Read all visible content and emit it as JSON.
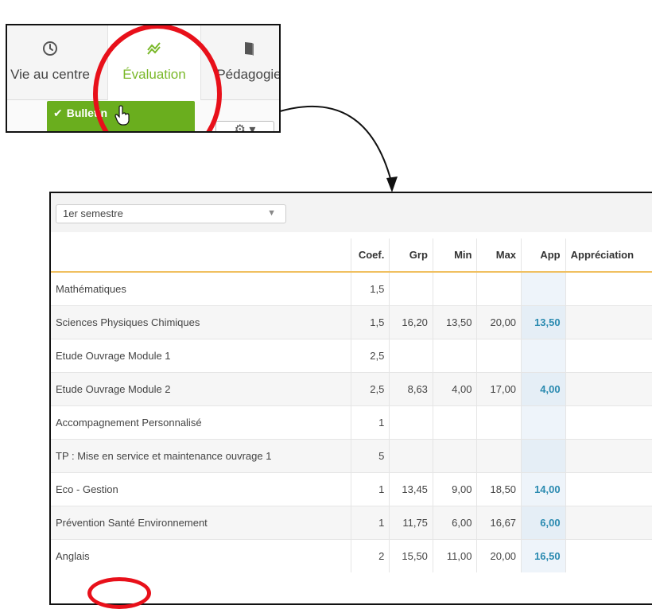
{
  "nav": {
    "tabs": [
      {
        "label": "Vie au centre",
        "icon": "clock-icon"
      },
      {
        "label": "Évaluation",
        "icon": "trend-chart-icon"
      },
      {
        "label": "Pédagogie",
        "icon": "book-icon"
      }
    ],
    "bulletin_label": "Bulletin",
    "gear_caret": "▾",
    "active_color": "#7ab829"
  },
  "panel": {
    "semester": "1er semestre",
    "columns": [
      "Coef.",
      "Grp",
      "Min",
      "Max",
      "App",
      "Appréciation"
    ],
    "rows": [
      {
        "subject": "Mathématiques",
        "coef": "1,5",
        "grp": "",
        "min": "",
        "max": "",
        "app": ""
      },
      {
        "subject": "Sciences Physiques Chimiques",
        "coef": "1,5",
        "grp": "16,20",
        "min": "13,50",
        "max": "20,00",
        "app": "13,50"
      },
      {
        "subject": "Etude Ouvrage Module 1",
        "coef": "2,5",
        "grp": "",
        "min": "",
        "max": "",
        "app": ""
      },
      {
        "subject": "Etude Ouvrage Module 2",
        "coef": "2,5",
        "grp": "8,63",
        "min": "4,00",
        "max": "17,00",
        "app": "4,00"
      },
      {
        "subject": "Accompagnement Personnalisé",
        "coef": "1",
        "grp": "",
        "min": "",
        "max": "",
        "app": ""
      },
      {
        "subject": "TP : Mise en service et maintenance ouvrage 1",
        "coef": "5",
        "grp": "",
        "min": "",
        "max": "",
        "app": ""
      },
      {
        "subject": "Eco - Gestion",
        "coef": "1",
        "grp": "13,45",
        "min": "9,00",
        "max": "18,50",
        "app": "14,00"
      },
      {
        "subject": "Prévention Santé Environnement",
        "coef": "1",
        "grp": "11,75",
        "min": "6,00",
        "max": "16,67",
        "app": "6,00"
      },
      {
        "subject": "Anglais",
        "coef": "2",
        "grp": "15,50",
        "min": "11,00",
        "max": "20,00",
        "app": "16,50"
      }
    ]
  }
}
